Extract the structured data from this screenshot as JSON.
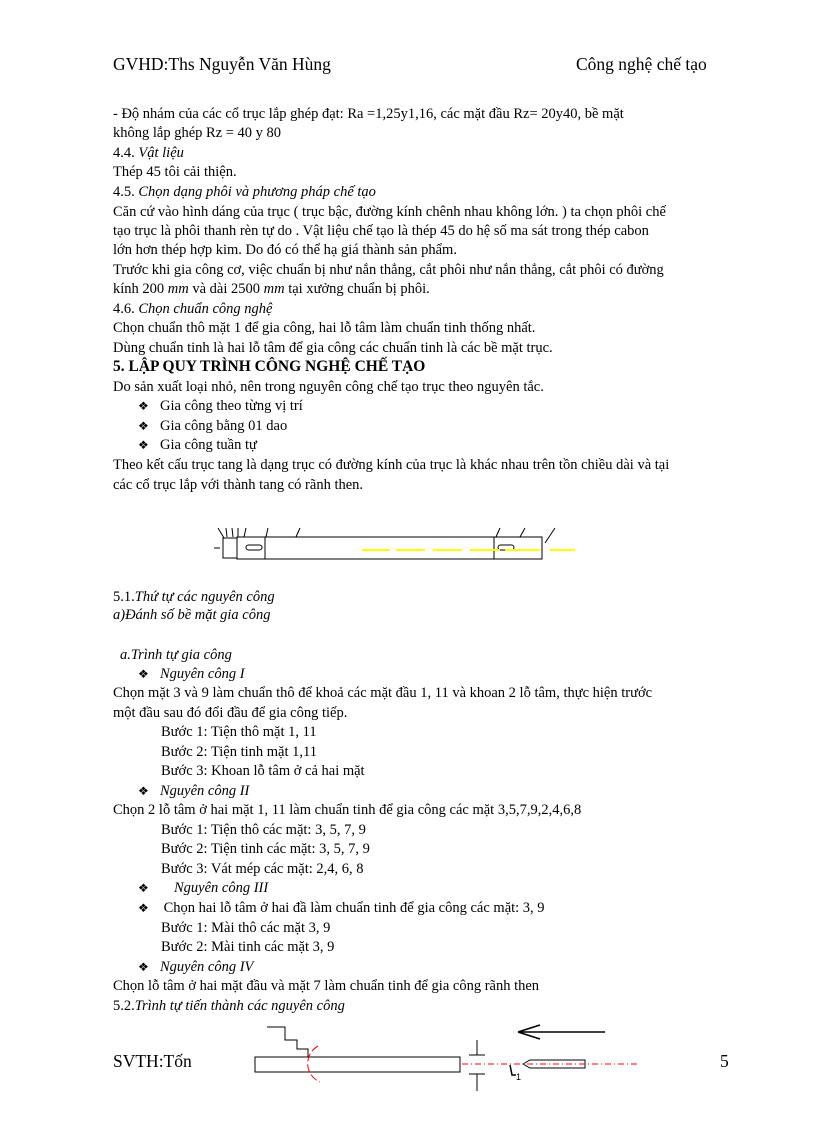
{
  "header": {
    "left": "GVHD:Ths Nguyễn Văn Hùng",
    "right": "Công nghệ chế tạo"
  },
  "bullet_glyph": "❖",
  "body": {
    "p1a": "- Độ nhám  của các cổ trục lắp ghép đạt: Ra =1,25y1,16, các mặt đầu    Rz= 20y40, bề mặt",
    "p1b": "không lắp ghép    Rz    = 40 y 80",
    "s44_num": "4.4. ",
    "s44_title": "Vật liệu",
    "s44_text": " Thép 45 tôi cải thiện.",
    "s45_num": "4.5. ",
    "s45_title": "Chọn dạng phôi và phương pháp chế tạo",
    "s45_p1": "Căn cứ vào hình  dáng của trục ( trục bậc, đường kính  chênh nhau không lớn. ) ta chọn phôi chế",
    "s45_p2": "tạo trục là phôi thanh rèn tự do . Vật liệu  chế tạo là thép 45 do hệ số ma sát trong thép  cabon",
    "s45_p3": "lớn  hơn thép hợp kim.  Do đó có thể hạ giá thành  sản phẩm.",
    "s45_p4": "Trước khi gia  công cơ, việc  chuẩn  bị như nắn thẳng,  cắt phôi như nắn thẳng,  cắt phôi có đường",
    "s45_p5a": "kính  200 ",
    "s45_p5_unit1": "mm",
    "s45_p5b": " và dài 2500 ",
    "s45_p5_unit2": "mm",
    "s45_p5c": " tại xưởng  chuẩn  bị phôi.",
    "s46_num": "4.6. ",
    "s46_title": "Chọn chuẩn công nghệ",
    "s46_p1": "Chọn chuẩn thô mặt 1 để gia công, hai lỗ tâm làm  chuẩn  tinh  thống  nhất.",
    "s46_p2": "Dùng  chuẩn tinh  là hai lỗ tâm để gia công các chuẩn  tinh  là các bề mặt trục.",
    "s5_heading": "5. LẬP QUY  TRÌNH CÔNG NGHỆ CHẾ TẠO",
    "s5_p1": "Do sản xuất loại nhỏ, nên trong nguyên  công chế tạo trục theo nguyên  tắc.",
    "s5_bullets": [
      "Gia công theo từng vị trí",
      "Gia công bằng 01 dao",
      "Gia công tuần tự"
    ],
    "s5_p2": "Theo kết cấu trục tang là dạng trục có đường kính  của trục là khác nhau trên tồn chiều  dài và tại",
    "s5_p3": "các cổ trục lắp với thành  tang có rãnh  then.",
    "s51_num": "5.1.",
    "s51_title": "Thứ tự các nguyên công",
    "s51_a": "a)Đánh số bề mặt gia công",
    "s51_seq": "a.Trình tự gia công",
    "nc1": "Nguyên công I",
    "nc1_p1": "Chọn mặt 3 và 9 làm  chuẩn  thô  để khoả các mặt đầu 1, 11 và khoan 2 lỗ tâm, thực hiện  trước",
    "nc1_p2": "một  đầu sau đó đổi đầu để gia  công tiếp.",
    "nc1_steps": [
      "Bước 1: Tiện thô mặt  1, 11",
      "Bước 2: Tiện tinh  mặt  1,11",
      "Bước 3: Khoan lỗ tâm ở cả hai  mặt"
    ],
    "nc2": "Nguyên công II",
    "nc2_p1": "Chọn 2 lỗ tâm ở hai mặt  1, 11 làm  chuẩn  tinh  để gia  công các mặt  3,5,7,9,2,4,6,8",
    "nc2_steps": [
      "Bước 1: Tiện thô các mặt:  3, 5, 7, 9",
      "Bước 2: Tiện tinh  các mặt:  3, 5, 7, 9",
      "Bước 3: Vát mép các mặt:   2,4, 6, 8"
    ],
    "nc3": "Nguyên công III",
    "nc3_p1": " Chọn hai lỗ  tâm  ở hai  đầ làm  chuẩn  tinh  để gia  công các mặt:  3, 9",
    "nc3_steps": [
      "Bước 1: Mài thô  các mặt    3, 9",
      "Bước 2: Mài tinh  các mặt   3, 9"
    ],
    "nc4": "Nguyên công IV",
    "nc4_p1": "Chọn lỗ tâm ở hai mặt đầu và mặt 7 làm  chuẩn  tinh  để gia  công rãnh  then",
    "s52_num": "5.2.",
    "s52_title": "Trình tự tiến thành các  nguyên công"
  },
  "figure_labels": {
    "surface_mark": "1"
  },
  "footer": {
    "left": "SVTH:Tốn",
    "page_number": "5"
  },
  "colors": {
    "centerline": "#ffff00",
    "tool_path": "#ff0000"
  }
}
